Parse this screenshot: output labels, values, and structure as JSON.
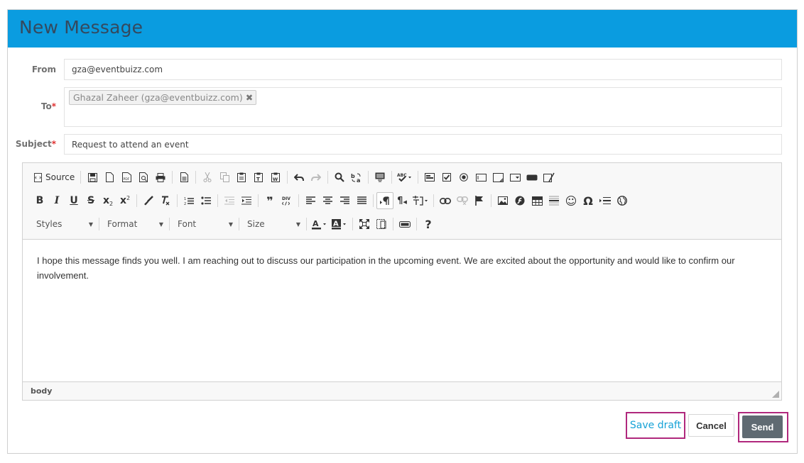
{
  "dialog": {
    "title": "New Message"
  },
  "form": {
    "from": {
      "label": "From",
      "value": "gza@eventbuizz.com"
    },
    "to": {
      "label": "To",
      "required": "*",
      "recipients": [
        {
          "label": "Ghazal Zaheer (gza@eventbuizz.com)",
          "remove": "✖"
        }
      ]
    },
    "subject": {
      "label": "Subject",
      "required": "*",
      "value": "Request to attend an event"
    }
  },
  "editor": {
    "toolbar": {
      "source_label": "Source",
      "dropdowns": {
        "styles": "Styles",
        "format": "Format",
        "font": "Font",
        "size": "Size"
      },
      "icons": {
        "bold": "B",
        "italic": "I",
        "underline": "U",
        "strike": "S",
        "subscript": "x",
        "superscript": "x",
        "blockquote": "❞",
        "special_char": "Ω",
        "help": "?",
        "smiley": "☺",
        "paragraph": "¶"
      }
    },
    "body_text": "I hope this message finds you well. I am reaching out to discuss our participation in the upcoming event. We are excited about the opportunity and would like to confirm our involvement.",
    "status_path": "body"
  },
  "actions": {
    "save_draft": "Save draft",
    "cancel": "Cancel",
    "send": "Send"
  },
  "colors": {
    "header_bg": "#0a9ce0",
    "title": "#34495e",
    "highlight": "#b0287d",
    "link": "#16a2d7",
    "send_bg": "#5f6a72"
  }
}
